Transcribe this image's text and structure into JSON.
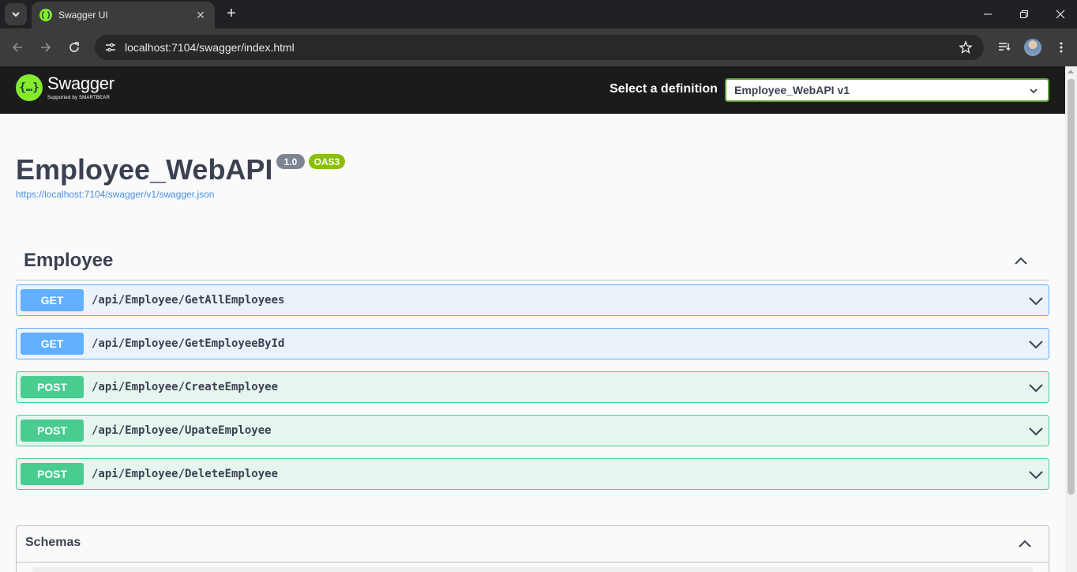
{
  "browser": {
    "tab_title": "Swagger UI",
    "url": "localhost:7104/swagger/index.html"
  },
  "swagger": {
    "brand": "Swagger",
    "supported_by": "Supported by SMARTBEAR",
    "definition_label": "Select a definition",
    "definition_selected": "Employee_WebAPI v1"
  },
  "info": {
    "title": "Employee_WebAPI",
    "version": "1.0",
    "oas": "OAS3",
    "spec_url": "https://localhost:7104/swagger/v1/swagger.json"
  },
  "tag": {
    "name": "Employee"
  },
  "operations": [
    {
      "method": "GET",
      "path": "/api/Employee/GetAllEmployees"
    },
    {
      "method": "GET",
      "path": "/api/Employee/GetEmployeeById"
    },
    {
      "method": "POST",
      "path": "/api/Employee/CreateEmployee"
    },
    {
      "method": "POST",
      "path": "/api/Employee/UpateEmployee"
    },
    {
      "method": "POST",
      "path": "/api/Employee/DeleteEmployee"
    }
  ],
  "schemas": {
    "title": "Schemas"
  },
  "colors": {
    "get": "#61affe",
    "post": "#49cc90",
    "swagger_green": "#85ea2d"
  }
}
